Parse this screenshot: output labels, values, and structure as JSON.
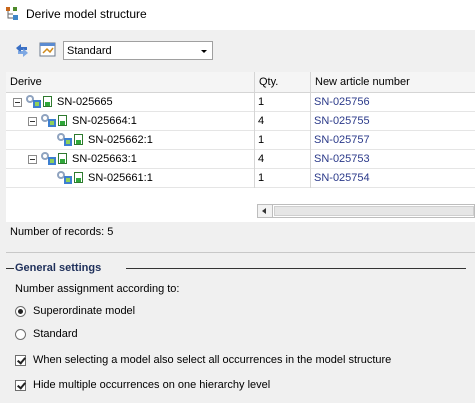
{
  "window": {
    "title": "Derive model structure"
  },
  "toolbar": {
    "combo_value": "Standard"
  },
  "grid": {
    "columns": [
      "Derive",
      "Qty.",
      "New article number"
    ],
    "rows": [
      {
        "name": "SN-025665",
        "qty": "1",
        "new_number": "SN-025756",
        "level": 0,
        "expandable": true
      },
      {
        "name": "SN-025664:1",
        "qty": "4",
        "new_number": "SN-025755",
        "level": 1,
        "expandable": true
      },
      {
        "name": "SN-025662:1",
        "qty": "1",
        "new_number": "SN-025757",
        "level": 2,
        "expandable": false
      },
      {
        "name": "SN-025663:1",
        "qty": "4",
        "new_number": "SN-025753",
        "level": 1,
        "expandable": true
      },
      {
        "name": "SN-025661:1",
        "qty": "1",
        "new_number": "SN-025754",
        "level": 2,
        "expandable": false
      }
    ]
  },
  "records_text": "Number of records: 5",
  "settings": {
    "group_title": "General settings",
    "number_assignment_label": "Number assignment according to:",
    "radio_superordinate": "Superordinate model",
    "radio_standard": "Standard",
    "selected_radio": "Superordinate model",
    "check_select_all": "When selecting a model also select all occurrences in the model structure",
    "check_hide_multiple": "Hide multiple occurrences on one hierarchy level",
    "check_select_all_checked": true,
    "check_hide_multiple_checked": true
  },
  "icons": [
    "model-tree-icon",
    "refresh-icon",
    "settings-window-icon",
    "expand-collapse-icon",
    "model-assembly-icon",
    "document-icon"
  ]
}
